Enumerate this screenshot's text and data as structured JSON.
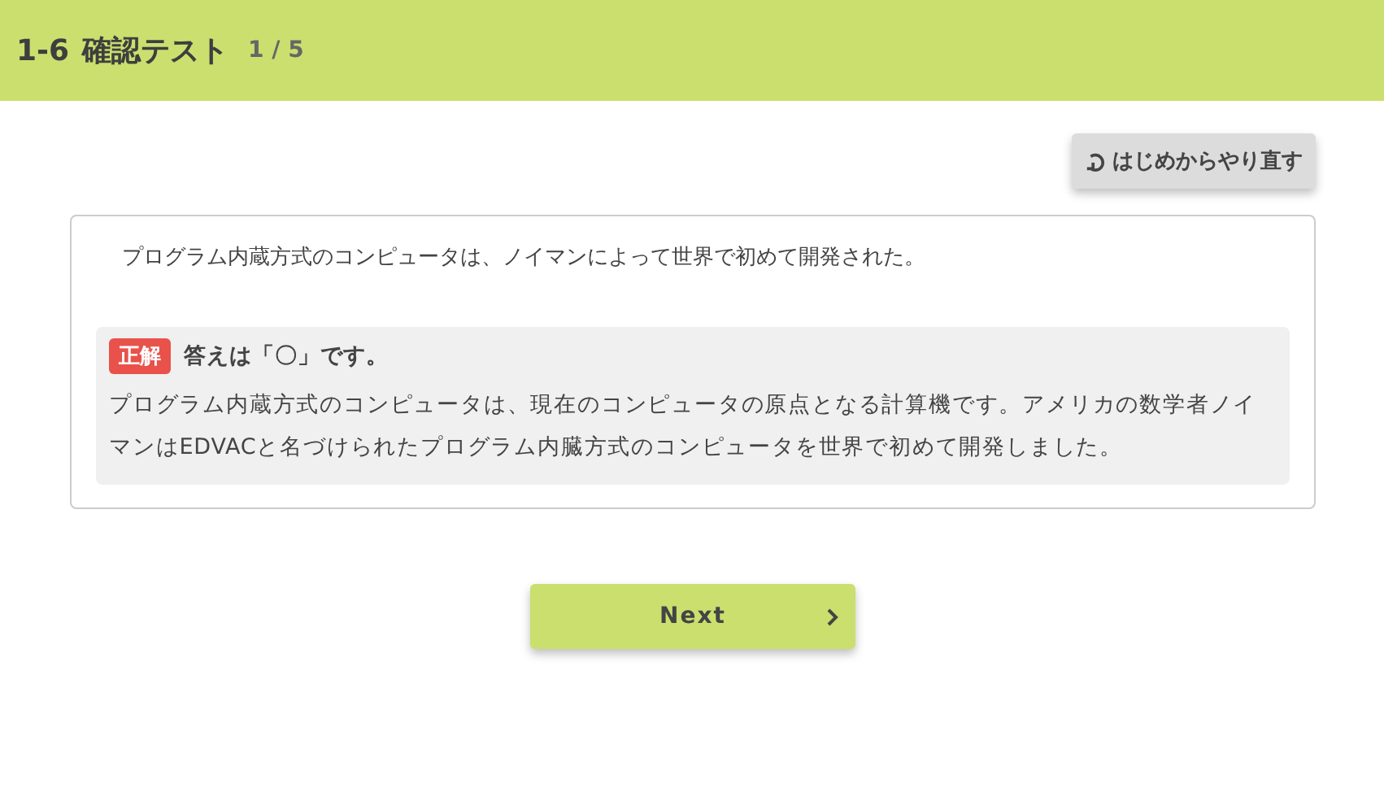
{
  "header": {
    "section": "1-6",
    "title": "確認テスト",
    "progress": "1 / 5"
  },
  "restart_button": {
    "label": "はじめからやり直す"
  },
  "question": {
    "text": "プログラム内蔵方式のコンピュータは、ノイマンによって世界で初めて開発された。"
  },
  "result": {
    "correct": true,
    "badge": "正解",
    "answer": "答えは「〇」です。",
    "explanation": "プログラム内蔵方式のコンピュータは、現在のコンピュータの原点となる計算機です。アメリカの数学者ノイマンはEDVACと名づけられたプログラム内臓方式のコンピュータを世界で初めて開発しました。"
  },
  "next_button": {
    "label": "Next"
  }
}
